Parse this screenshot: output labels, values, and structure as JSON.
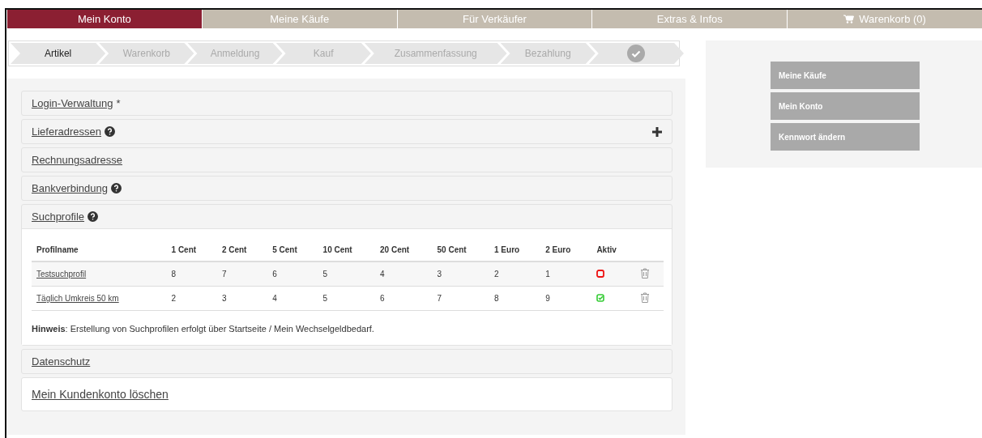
{
  "nav": [
    {
      "label": "Mein Konto",
      "selected": true,
      "cart": false
    },
    {
      "label": "Meine Käufe",
      "selected": false,
      "cart": false
    },
    {
      "label": "Für Verkäufer",
      "selected": false,
      "cart": false
    },
    {
      "label": "Extras & Infos",
      "selected": false,
      "cart": false
    },
    {
      "label": "Warenkorb (0)",
      "selected": false,
      "cart": true
    }
  ],
  "steps": [
    {
      "kind": "text",
      "label": "Artikel",
      "selected": true
    },
    {
      "kind": "text",
      "label": "Warenkorb",
      "selected": false
    },
    {
      "kind": "text",
      "label": "Anmeldung",
      "selected": false
    },
    {
      "kind": "text",
      "label": "Kauf",
      "selected": false
    },
    {
      "kind": "text",
      "label": "Zusammenfassung",
      "selected": false
    },
    {
      "kind": "text",
      "label": "Bezahlung",
      "selected": false
    },
    {
      "kind": "check",
      "selected": false
    }
  ],
  "sections": [
    {
      "kind": "panel",
      "title": "Login-Verwaltung",
      "suffix": "*",
      "help": false,
      "add": false,
      "expanded": false
    },
    {
      "kind": "panel",
      "title": "Lieferadressen",
      "help": true,
      "add": true,
      "expanded": false
    },
    {
      "kind": "panel",
      "title": "Rechnungsadresse",
      "help": false,
      "add": false,
      "expanded": false
    },
    {
      "kind": "panel",
      "title": "Bankverbindung",
      "help": true,
      "add": false,
      "expanded": false
    },
    {
      "kind": "panel",
      "title": "Suchprofile",
      "help": true,
      "add": false,
      "expanded": true,
      "table": {
        "columns": [
          "Profilname",
          "1 Cent",
          "2 Cent",
          "5 Cent",
          "10 Cent",
          "20 Cent",
          "50 Cent",
          "1 Euro",
          "2 Euro",
          "Aktiv"
        ],
        "rows": [
          {
            "name": "Testsuchprofil",
            "values": [
              "8",
              "7",
              "6",
              "5",
              "4",
              "3",
              "2",
              "1"
            ],
            "active": false
          },
          {
            "name": "Täglich Umkreis 50 km",
            "values": [
              "2",
              "3",
              "4",
              "5",
              "6",
              "7",
              "8",
              "9"
            ],
            "active": true
          }
        ]
      },
      "note": "**Hinweis**: Erstellung von Suchprofilen erfolgt über Startseite / Mein Wechselgeldbedarf."
    },
    {
      "kind": "panel",
      "title": "Datenschutz",
      "help": false,
      "add": false,
      "expanded": false
    },
    {
      "kind": "link",
      "title": "Mein Kundenkonto löschen",
      "help": false,
      "add": false,
      "expanded": false
    }
  ],
  "sidebar": {
    "items": [
      "Meine Käufe",
      "Mein Konto",
      "Kennwort ändern"
    ]
  }
}
